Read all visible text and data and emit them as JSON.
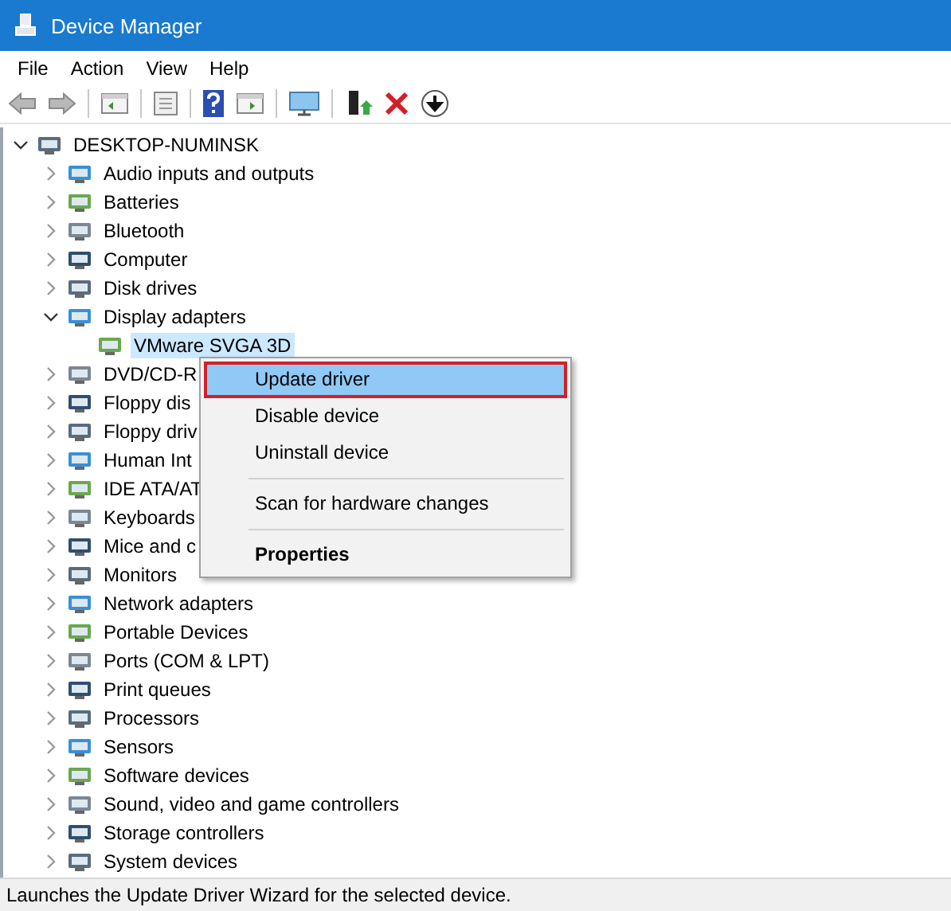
{
  "window": {
    "title": "Device Manager"
  },
  "menu_bar": [
    {
      "label": "File"
    },
    {
      "label": "Action"
    },
    {
      "label": "View"
    },
    {
      "label": "Help"
    }
  ],
  "tree": [
    {
      "label": "DESKTOP-NUMINSK",
      "expanded": true,
      "children": [
        {
          "label": "Audio inputs and outputs",
          "expanded": false
        },
        {
          "label": "Batteries",
          "expanded": false
        },
        {
          "label": "Bluetooth",
          "expanded": false
        },
        {
          "label": "Computer",
          "expanded": false
        },
        {
          "label": "Disk drives",
          "expanded": false
        },
        {
          "label": "Display adapters",
          "expanded": true,
          "children": [
            {
              "label": "VMware SVGA 3D",
              "selected": true
            }
          ]
        },
        {
          "label": "DVD/CD-R",
          "expanded": false
        },
        {
          "label": "Floppy dis",
          "expanded": false
        },
        {
          "label": "Floppy driv",
          "expanded": false
        },
        {
          "label": "Human Int",
          "expanded": false
        },
        {
          "label": "IDE ATA/AT",
          "expanded": false
        },
        {
          "label": "Keyboards",
          "expanded": false
        },
        {
          "label": "Mice and c",
          "expanded": false
        },
        {
          "label": "Monitors",
          "expanded": false
        },
        {
          "label": "Network adapters",
          "expanded": false
        },
        {
          "label": "Portable Devices",
          "expanded": false
        },
        {
          "label": "Ports (COM & LPT)",
          "expanded": false
        },
        {
          "label": "Print queues",
          "expanded": false
        },
        {
          "label": "Processors",
          "expanded": false
        },
        {
          "label": "Sensors",
          "expanded": false
        },
        {
          "label": "Software devices",
          "expanded": false
        },
        {
          "label": "Sound, video and game controllers",
          "expanded": false
        },
        {
          "label": "Storage controllers",
          "expanded": false
        },
        {
          "label": "System devices",
          "expanded": false
        }
      ]
    }
  ],
  "context_menu": [
    {
      "kind": "item",
      "label": "Update driver",
      "selected": true
    },
    {
      "kind": "item",
      "label": "Disable device",
      "selected": false
    },
    {
      "kind": "item",
      "label": "Uninstall device",
      "selected": false
    },
    {
      "kind": "separator"
    },
    {
      "kind": "item",
      "label": "Scan for hardware changes",
      "selected": false
    },
    {
      "kind": "separator"
    },
    {
      "kind": "default",
      "label": "Properties",
      "selected": false
    }
  ],
  "status_bar": "Launches the Update Driver Wizard for the selected device."
}
